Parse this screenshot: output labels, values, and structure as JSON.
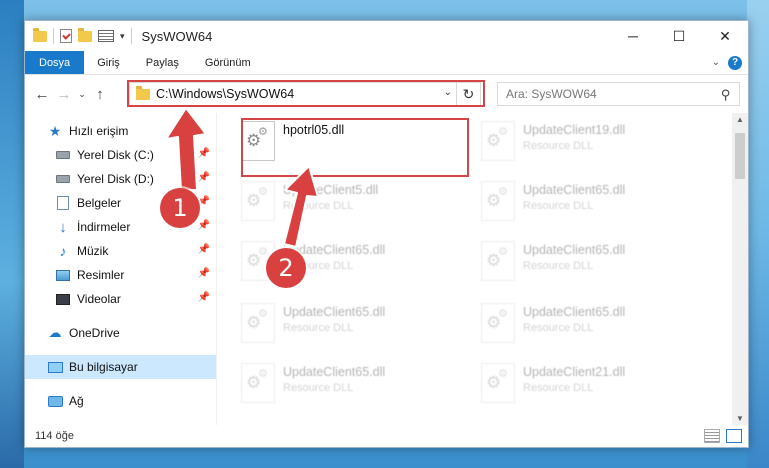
{
  "window": {
    "title": "SysWOW64",
    "controls": {
      "minimize": "─",
      "maximize": "☐",
      "close": "✕"
    }
  },
  "ribbon": {
    "tabs": [
      "Dosya",
      "Giriş",
      "Paylaş",
      "Görünüm"
    ],
    "help": "?"
  },
  "nav": {
    "back": "←",
    "forward": "→",
    "recent": "⌄",
    "up": "↑",
    "address": "C:\\Windows\\SysWOW64",
    "refresh": "↻",
    "search_placeholder": "Ara: SysWOW64"
  },
  "sidebar": {
    "quick_access": "Hızlı erişim",
    "items": [
      {
        "label": "Yerel Disk (C:)",
        "icon": "drive-icon"
      },
      {
        "label": "Yerel Disk (D:)",
        "icon": "drive-icon"
      },
      {
        "label": "Belgeler",
        "icon": "documents-icon"
      },
      {
        "label": "İndirmeler",
        "icon": "downloads-icon"
      },
      {
        "label": "Müzik",
        "icon": "music-icon"
      },
      {
        "label": "Resimler",
        "icon": "pictures-icon"
      },
      {
        "label": "Videolar",
        "icon": "videos-icon"
      }
    ],
    "onedrive": "OneDrive",
    "this_pc": "Bu bilgisayar",
    "network": "Ağ"
  },
  "files": {
    "highlighted": {
      "name": "hpotrl05.dll",
      "type": ""
    },
    "others": [
      {
        "name": "UpdateClient19.dll",
        "type": "Resource DLL"
      },
      {
        "name": "UpdateClient5.dll",
        "type": "Resource DLL"
      },
      {
        "name": "UpdateClient65.dll",
        "type": "Resource DLL"
      },
      {
        "name": "UpdateClient65.dll",
        "type": "Resource DLL"
      },
      {
        "name": "UpdateClient65.dll",
        "type": "Resource DLL"
      },
      {
        "name": "UpdateClient65.dll",
        "type": "Resource DLL"
      },
      {
        "name": "UpdateClient65.dll",
        "type": "Resource DLL"
      },
      {
        "name": "UpdateClient65.dll",
        "type": "Resource DLL"
      },
      {
        "name": "UpdateClient21.dll",
        "type": "Resource DLL"
      }
    ]
  },
  "status": {
    "count": "114 öğe"
  },
  "annotations": {
    "step1": "1",
    "step2": "2",
    "color": "#d94141"
  }
}
